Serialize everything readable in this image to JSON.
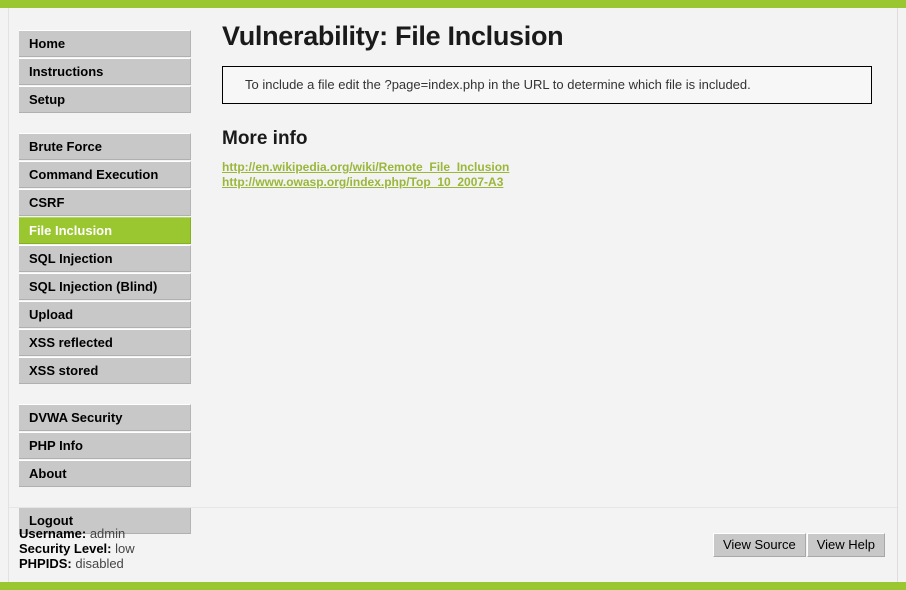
{
  "theme": {
    "accent_green": "#9ac630",
    "nav_gray": "#c8c8c8",
    "page_bg": "#f3f3f3",
    "link_green": "#9bb73a"
  },
  "sidebar": {
    "groups": [
      {
        "items": [
          {
            "label": "Home",
            "active": false
          },
          {
            "label": "Instructions",
            "active": false
          },
          {
            "label": "Setup",
            "active": false
          }
        ]
      },
      {
        "items": [
          {
            "label": "Brute Force",
            "active": false
          },
          {
            "label": "Command Execution",
            "active": false
          },
          {
            "label": "CSRF",
            "active": false
          },
          {
            "label": "File Inclusion",
            "active": true
          },
          {
            "label": "SQL Injection",
            "active": false
          },
          {
            "label": "SQL Injection (Blind)",
            "active": false
          },
          {
            "label": "Upload",
            "active": false
          },
          {
            "label": "XSS reflected",
            "active": false
          },
          {
            "label": "XSS stored",
            "active": false
          }
        ]
      },
      {
        "items": [
          {
            "label": "DVWA Security",
            "active": false
          },
          {
            "label": "PHP Info",
            "active": false
          },
          {
            "label": "About",
            "active": false
          }
        ]
      },
      {
        "items": [
          {
            "label": "Logout",
            "active": false
          }
        ]
      }
    ]
  },
  "main": {
    "title": "Vulnerability: File Inclusion",
    "info_text": "To include a file edit the ?page=index.php in the URL to determine which file is included.",
    "more_info_heading": "More info",
    "links": [
      "http://en.wikipedia.org/wiki/Remote_File_Inclusion",
      "http://www.owasp.org/index.php/Top_10_2007-A3"
    ]
  },
  "footer": {
    "status": [
      {
        "key": "Username:",
        "value": "admin"
      },
      {
        "key": "Security Level:",
        "value": "low"
      },
      {
        "key": "PHPIDS:",
        "value": "disabled"
      }
    ],
    "buttons": [
      {
        "label": "View Source"
      },
      {
        "label": "View Help"
      }
    ]
  }
}
